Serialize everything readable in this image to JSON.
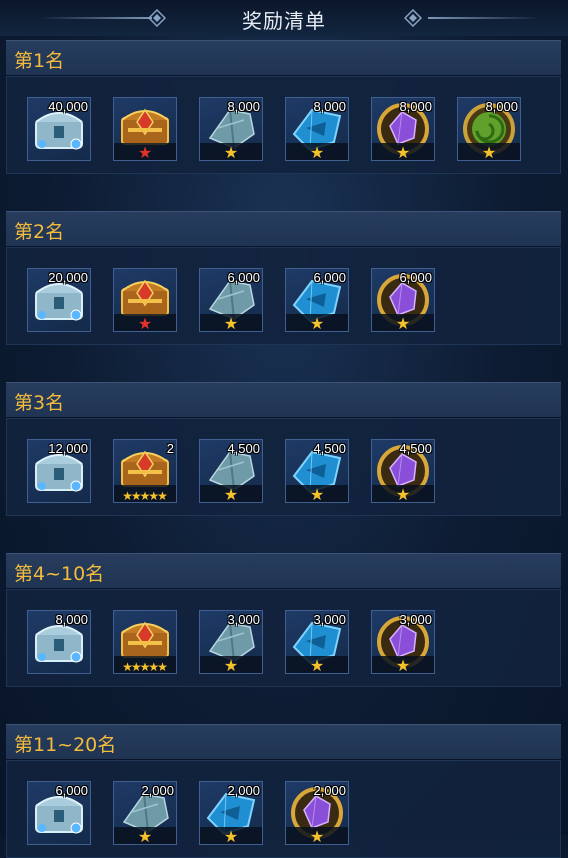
{
  "title": "奖励清单",
  "sections": [
    {
      "label": "第1名",
      "items": [
        {
          "type": "chest-silver",
          "qty": "40,000",
          "stars": 0,
          "star_color": ""
        },
        {
          "type": "chest-gold",
          "qty": "",
          "stars": 1,
          "star_color": "red"
        },
        {
          "type": "stone-gray",
          "qty": "8,000",
          "stars": 1,
          "star_color": "gold"
        },
        {
          "type": "stone-blue",
          "qty": "8,000",
          "stars": 1,
          "star_color": "gold"
        },
        {
          "type": "stone-purple",
          "qty": "8,000",
          "stars": 1,
          "star_color": "gold"
        },
        {
          "type": "stone-green",
          "qty": "8,000",
          "stars": 1,
          "star_color": "gold"
        }
      ]
    },
    {
      "label": "第2名",
      "items": [
        {
          "type": "chest-silver",
          "qty": "20,000",
          "stars": 0,
          "star_color": ""
        },
        {
          "type": "chest-gold",
          "qty": "",
          "stars": 1,
          "star_color": "red"
        },
        {
          "type": "stone-gray",
          "qty": "6,000",
          "stars": 1,
          "star_color": "gold"
        },
        {
          "type": "stone-blue",
          "qty": "6,000",
          "stars": 1,
          "star_color": "gold"
        },
        {
          "type": "stone-purple",
          "qty": "6,000",
          "stars": 1,
          "star_color": "gold"
        }
      ]
    },
    {
      "label": "第3名",
      "items": [
        {
          "type": "chest-silver",
          "qty": "12,000",
          "stars": 0,
          "star_color": ""
        },
        {
          "type": "chest-gold",
          "qty": "2",
          "stars": 5,
          "star_color": "gold"
        },
        {
          "type": "stone-gray",
          "qty": "4,500",
          "stars": 1,
          "star_color": "gold"
        },
        {
          "type": "stone-blue",
          "qty": "4,500",
          "stars": 1,
          "star_color": "gold"
        },
        {
          "type": "stone-purple",
          "qty": "4,500",
          "stars": 1,
          "star_color": "gold"
        }
      ]
    },
    {
      "label": "第4~10名",
      "items": [
        {
          "type": "chest-silver",
          "qty": "8,000",
          "stars": 0,
          "star_color": ""
        },
        {
          "type": "chest-gold",
          "qty": "",
          "stars": 5,
          "star_color": "gold"
        },
        {
          "type": "stone-gray",
          "qty": "3,000",
          "stars": 1,
          "star_color": "gold"
        },
        {
          "type": "stone-blue",
          "qty": "3,000",
          "stars": 1,
          "star_color": "gold"
        },
        {
          "type": "stone-purple",
          "qty": "3,000",
          "stars": 1,
          "star_color": "gold"
        }
      ]
    },
    {
      "label": "第11~20名",
      "items": [
        {
          "type": "chest-silver",
          "qty": "6,000",
          "stars": 0,
          "star_color": ""
        },
        {
          "type": "stone-gray",
          "qty": "2,000",
          "stars": 1,
          "star_color": "gold"
        },
        {
          "type": "stone-blue",
          "qty": "2,000",
          "stars": 1,
          "star_color": "gold"
        },
        {
          "type": "stone-purple",
          "qty": "2,000",
          "stars": 1,
          "star_color": "gold"
        }
      ]
    }
  ],
  "colors": {
    "rank_label": "#f2bb3c",
    "star_gold": "#f5c22c",
    "star_red": "#e23327"
  }
}
